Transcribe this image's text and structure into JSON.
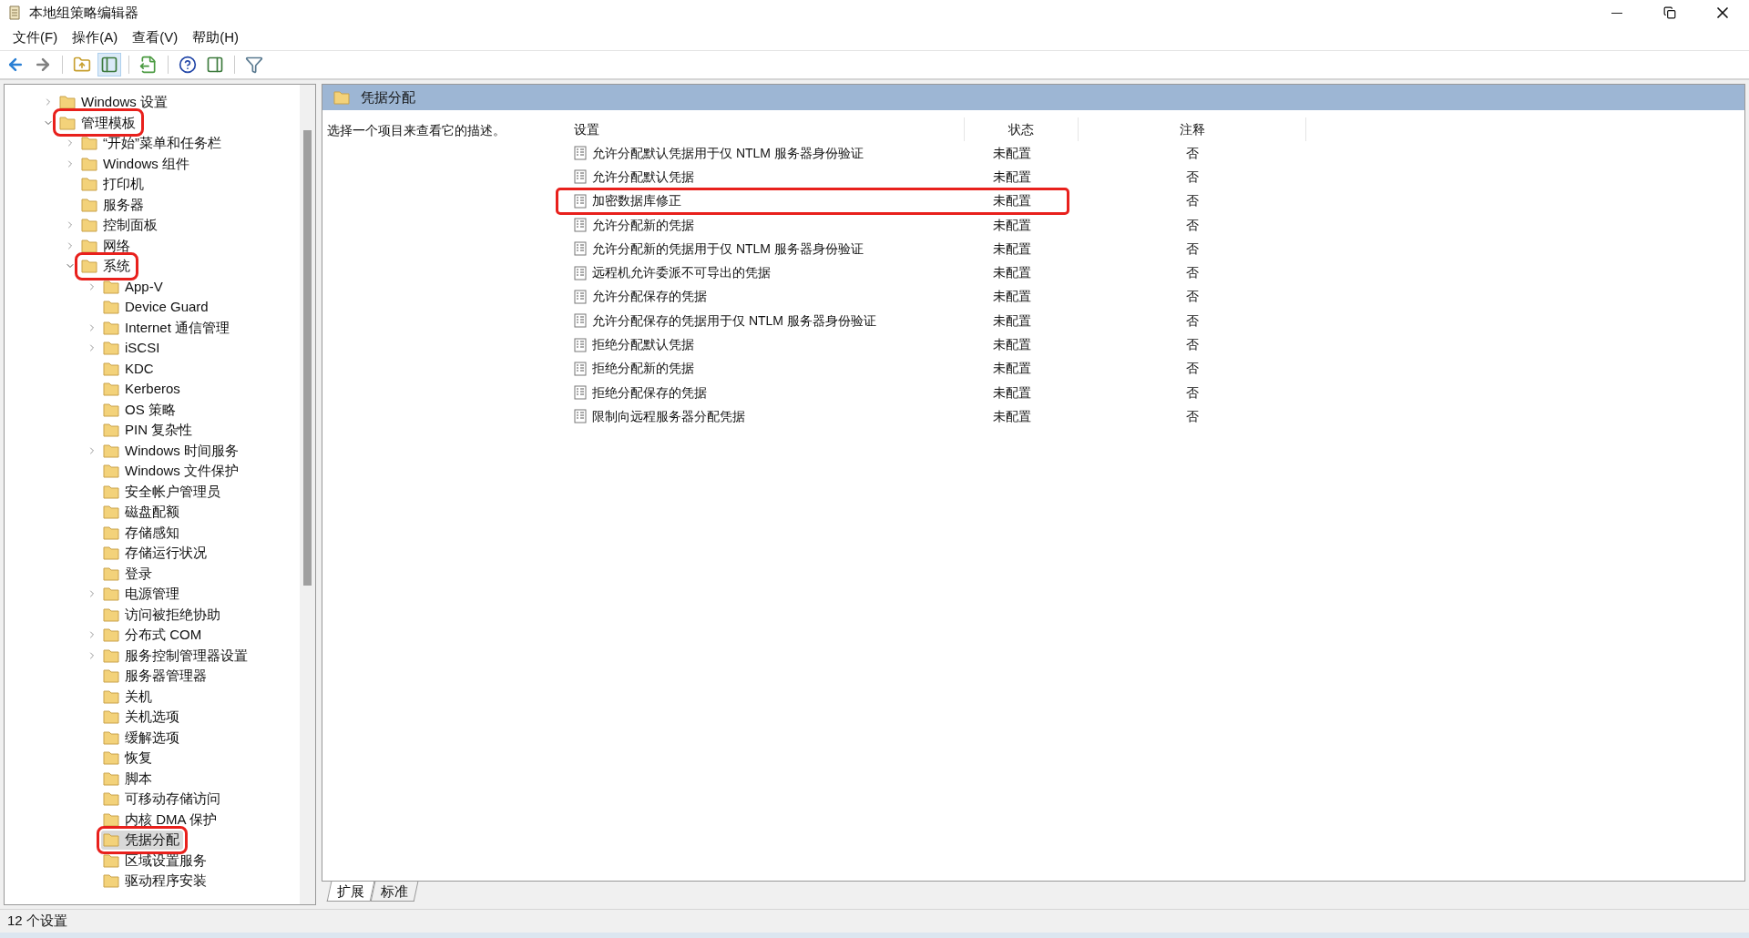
{
  "window": {
    "title": "本地组策略编辑器"
  },
  "menu": [
    "文件(F)",
    "操作(A)",
    "查看(V)",
    "帮助(H)"
  ],
  "toolbar": [
    {
      "kind": "back",
      "selected": false
    },
    {
      "kind": "forward",
      "selected": false
    },
    {
      "kind": "up",
      "selected": false
    },
    {
      "kind": "tree",
      "selected": true
    },
    {
      "kind": "export",
      "selected": false
    },
    {
      "kind": "help",
      "selected": false
    },
    {
      "kind": "view",
      "selected": false
    },
    {
      "kind": "filter",
      "selected": false
    }
  ],
  "tree": [
    {
      "label": "Windows 设置",
      "expanded": false,
      "selected": false,
      "marked": false
    },
    {
      "label": "管理模板",
      "expanded": true,
      "selected": false,
      "marked": true,
      "children": [
        {
          "label": "“开始”菜单和任务栏",
          "expanded": false,
          "selected": false,
          "marked": false
        },
        {
          "label": "Windows 组件",
          "expanded": false,
          "selected": false,
          "marked": false
        },
        {
          "label": "打印机",
          "selected": false,
          "marked": false
        },
        {
          "label": "服务器",
          "selected": false,
          "marked": false
        },
        {
          "label": "控制面板",
          "expanded": false,
          "selected": false,
          "marked": false
        },
        {
          "label": "网络",
          "expanded": false,
          "selected": false,
          "marked": false
        },
        {
          "label": "系统",
          "expanded": true,
          "selected": false,
          "marked": true,
          "children": [
            {
              "label": "App-V",
              "expanded": false,
              "selected": false,
              "marked": false
            },
            {
              "label": "Device Guard",
              "selected": false,
              "marked": false
            },
            {
              "label": "Internet 通信管理",
              "expanded": false,
              "selected": false,
              "marked": false
            },
            {
              "label": "iSCSI",
              "expanded": false,
              "selected": false,
              "marked": false
            },
            {
              "label": "KDC",
              "selected": false,
              "marked": false
            },
            {
              "label": "Kerberos",
              "selected": false,
              "marked": false
            },
            {
              "label": "OS 策略",
              "selected": false,
              "marked": false
            },
            {
              "label": "PIN 复杂性",
              "selected": false,
              "marked": false
            },
            {
              "label": "Windows 时间服务",
              "expanded": false,
              "selected": false,
              "marked": false
            },
            {
              "label": "Windows 文件保护",
              "selected": false,
              "marked": false
            },
            {
              "label": "安全帐户管理员",
              "selected": false,
              "marked": false
            },
            {
              "label": "磁盘配额",
              "selected": false,
              "marked": false
            },
            {
              "label": "存储感知",
              "selected": false,
              "marked": false
            },
            {
              "label": "存储运行状况",
              "selected": false,
              "marked": false
            },
            {
              "label": "登录",
              "selected": false,
              "marked": false
            },
            {
              "label": "电源管理",
              "expanded": false,
              "selected": false,
              "marked": false
            },
            {
              "label": "访问被拒绝协助",
              "selected": false,
              "marked": false
            },
            {
              "label": "分布式 COM",
              "expanded": false,
              "selected": false,
              "marked": false
            },
            {
              "label": "服务控制管理器设置",
              "expanded": false,
              "selected": false,
              "marked": false
            },
            {
              "label": "服务器管理器",
              "selected": false,
              "marked": false
            },
            {
              "label": "关机",
              "selected": false,
              "marked": false
            },
            {
              "label": "关机选项",
              "selected": false,
              "marked": false
            },
            {
              "label": "缓解选项",
              "selected": false,
              "marked": false
            },
            {
              "label": "恢复",
              "selected": false,
              "marked": false
            },
            {
              "label": "脚本",
              "selected": false,
              "marked": false
            },
            {
              "label": "可移动存储访问",
              "selected": false,
              "marked": false
            },
            {
              "label": "内核 DMA 保护",
              "selected": false,
              "marked": false
            },
            {
              "label": "凭据分配",
              "selected": true,
              "marked": true
            },
            {
              "label": "区域设置服务",
              "selected": false,
              "marked": false
            },
            {
              "label": "驱动程序安装",
              "selected": false,
              "marked": false
            }
          ]
        }
      ]
    }
  ],
  "header": {
    "title": "凭据分配"
  },
  "description": "选择一个项目来查看它的描述。",
  "table": {
    "columns": [
      "设置",
      "状态",
      "注释"
    ],
    "rows": [
      {
        "name": "允许分配默认凭据用于仅 NTLM 服务器身份验证",
        "state": "未配置",
        "comment": "否",
        "marked": false
      },
      {
        "name": "允许分配默认凭据",
        "state": "未配置",
        "comment": "否",
        "marked": false
      },
      {
        "name": "加密数据库修正",
        "state": "未配置",
        "comment": "否",
        "marked": true
      },
      {
        "name": "允许分配新的凭据",
        "state": "未配置",
        "comment": "否",
        "marked": false
      },
      {
        "name": "允许分配新的凭据用于仅 NTLM 服务器身份验证",
        "state": "未配置",
        "comment": "否",
        "marked": false
      },
      {
        "name": "远程机允许委派不可导出的凭据",
        "state": "未配置",
        "comment": "否",
        "marked": false
      },
      {
        "name": "允许分配保存的凭据",
        "state": "未配置",
        "comment": "否",
        "marked": false
      },
      {
        "name": "允许分配保存的凭据用于仅 NTLM 服务器身份验证",
        "state": "未配置",
        "comment": "否",
        "marked": false
      },
      {
        "name": "拒绝分配默认凭据",
        "state": "未配置",
        "comment": "否",
        "marked": false
      },
      {
        "name": "拒绝分配新的凭据",
        "state": "未配置",
        "comment": "否",
        "marked": false
      },
      {
        "name": "拒绝分配保存的凭据",
        "state": "未配置",
        "comment": "否",
        "marked": false
      },
      {
        "name": "限制向远程服务器分配凭据",
        "state": "未配置",
        "comment": "否",
        "marked": false
      }
    ]
  },
  "view_tabs": [
    {
      "label": "扩展",
      "selected": true
    },
    {
      "label": "标准",
      "selected": false
    }
  ],
  "status_bar": "12 个设置"
}
